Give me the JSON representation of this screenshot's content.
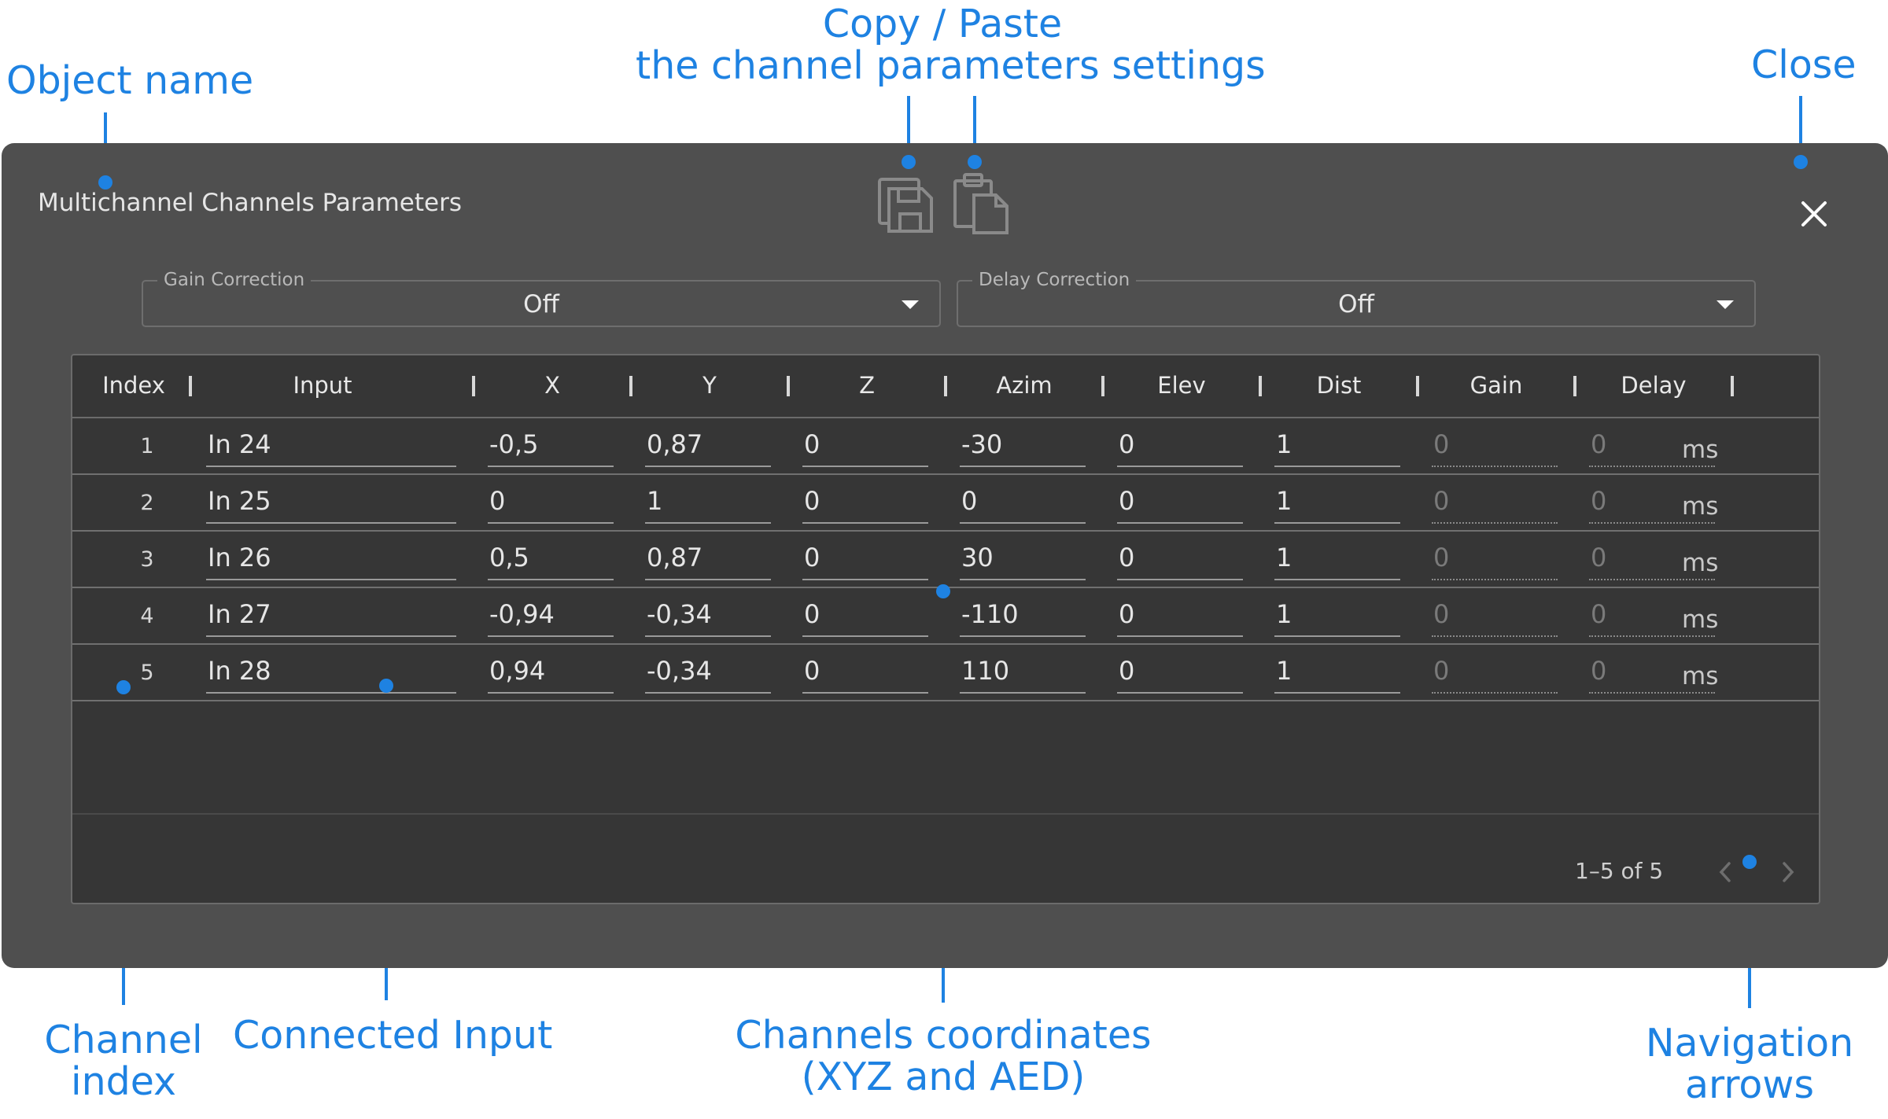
{
  "callouts": {
    "object_name": "Object name",
    "copy_paste_line1": "Copy / Paste",
    "copy_paste_line2": "the channel parameters settings",
    "close": "Close",
    "channel_index_line1": "Channel",
    "channel_index_line2": "index",
    "connected_input": "Connected Input",
    "coordinates_line1": "Channels coordinates",
    "coordinates_line2": "(XYZ and AED)",
    "navigation_line1": "Navigation",
    "navigation_line2": "arrows"
  },
  "dialog": {
    "title": "Multichannel Channels Parameters",
    "copy_icon": "copy-icon",
    "paste_icon": "paste-icon",
    "close_icon": "close-icon"
  },
  "gain_correction": {
    "label": "Gain Correction",
    "value": "Off"
  },
  "delay_correction": {
    "label": "Delay Correction",
    "value": "Off"
  },
  "table": {
    "headers": [
      "Index",
      "Input",
      "X",
      "Y",
      "Z",
      "Azim",
      "Elev",
      "Dist",
      "Gain",
      "Delay"
    ],
    "unit": "ms",
    "rows": [
      {
        "index": "1",
        "input": "In 24",
        "x": "-0,5",
        "y": "0,87",
        "z": "0",
        "azim": "-30",
        "elev": "0",
        "dist": "1",
        "gain": "0",
        "delay": "0"
      },
      {
        "index": "2",
        "input": "In 25",
        "x": "0",
        "y": "1",
        "z": "0",
        "azim": "0",
        "elev": "0",
        "dist": "1",
        "gain": "0",
        "delay": "0"
      },
      {
        "index": "3",
        "input": "In 26",
        "x": "0,5",
        "y": "0,87",
        "z": "0",
        "azim": "30",
        "elev": "0",
        "dist": "1",
        "gain": "0",
        "delay": "0"
      },
      {
        "index": "4",
        "input": "In 27",
        "x": "-0,94",
        "y": "-0,34",
        "z": "0",
        "azim": "-110",
        "elev": "0",
        "dist": "1",
        "gain": "0",
        "delay": "0"
      },
      {
        "index": "5",
        "input": "In 28",
        "x": "0,94",
        "y": "-0,34",
        "z": "0",
        "azim": "110",
        "elev": "0",
        "dist": "1",
        "gain": "0",
        "delay": "0"
      }
    ]
  },
  "pagination": {
    "info": "1–5 of 5",
    "prev_icon": "chevron-left-icon",
    "next_icon": "chevron-right-icon"
  },
  "colors": {
    "callout": "#1e82e2",
    "dialog_bg": "#4f4f4f",
    "table_bg": "#363636"
  }
}
